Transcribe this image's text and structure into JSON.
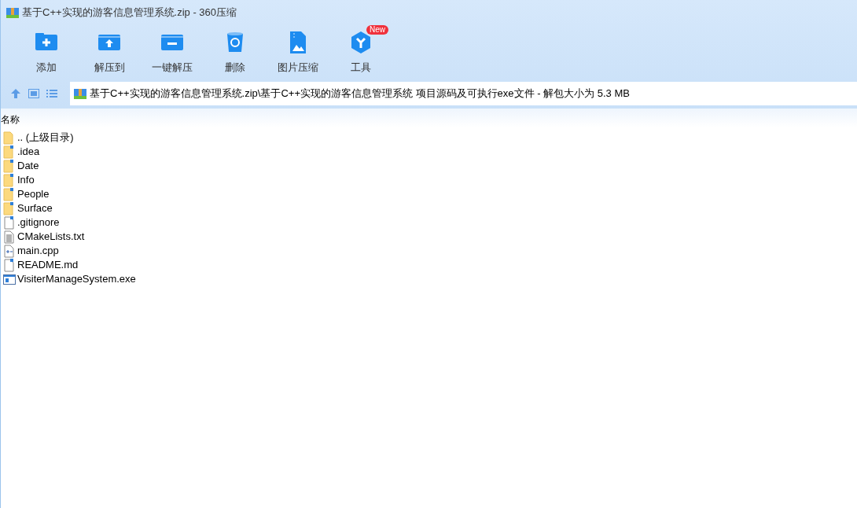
{
  "window": {
    "title": "基于C++实现的游客信息管理系统.zip - 360压缩"
  },
  "toolbar": [
    {
      "kind": "add",
      "label": "添加"
    },
    {
      "kind": "extract-to",
      "label": "解压到"
    },
    {
      "kind": "extract",
      "label": "一键解压"
    },
    {
      "kind": "delete",
      "label": "删除"
    },
    {
      "kind": "image",
      "label": "图片压缩"
    },
    {
      "kind": "tools",
      "label": "工具",
      "badge": "New"
    }
  ],
  "address_bar": {
    "path": "基于C++实现的游客信息管理系统.zip\\基于C++实现的游客信息管理系统 项目源码及可执行exe文件 - 解包大小为 5.3 MB"
  },
  "file_list": {
    "columns": [
      "名称"
    ],
    "rows": [
      {
        "kind": "parent",
        "name": ".. (上级目录)"
      },
      {
        "kind": "folder",
        "name": ".idea"
      },
      {
        "kind": "folder",
        "name": "Date"
      },
      {
        "kind": "folder",
        "name": "Info"
      },
      {
        "kind": "folder",
        "name": "People"
      },
      {
        "kind": "folder",
        "name": "Surface"
      },
      {
        "kind": "file",
        "name": ".gitignore"
      },
      {
        "kind": "text",
        "name": "CMakeLists.txt"
      },
      {
        "kind": "cpp",
        "name": "main.cpp"
      },
      {
        "kind": "file",
        "name": "README.md"
      },
      {
        "kind": "exe",
        "name": "VisiterManageSystem.exe"
      }
    ]
  }
}
